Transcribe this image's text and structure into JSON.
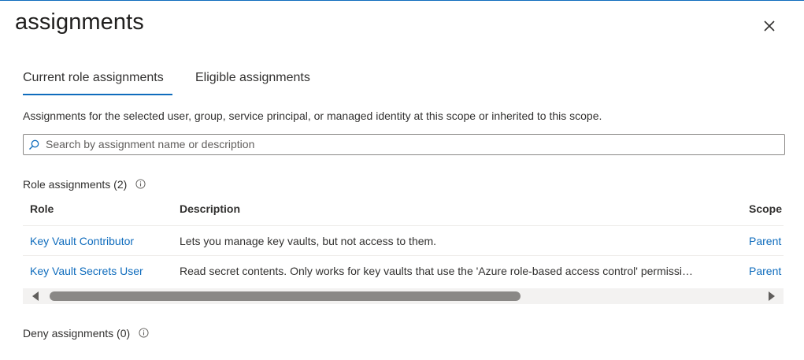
{
  "panel": {
    "title": "assignments",
    "close_icon": "close-icon"
  },
  "tabs": [
    {
      "label": "Current role assignments",
      "active": true
    },
    {
      "label": "Eligible assignments",
      "active": false
    }
  ],
  "description": "Assignments for the selected user, group, service principal, or managed identity at this scope or inherited to this scope.",
  "search": {
    "placeholder": "Search by assignment name or description",
    "value": "",
    "icon": "search-icon"
  },
  "role_assignments": {
    "label": "Role assignments (2)",
    "info_icon": "info-icon",
    "columns": [
      "Role",
      "Description",
      "Scope"
    ],
    "rows": [
      {
        "role": "Key Vault Contributor",
        "description": "Lets you manage key vaults, but not access to them.",
        "scope": "Parent"
      },
      {
        "role": "Key Vault Secrets User",
        "description": "Read secret contents. Only works for key vaults that use the 'Azure role-based access control' permissi…",
        "scope": "Parent"
      }
    ]
  },
  "deny_assignments": {
    "label": "Deny assignments (0)",
    "info_icon": "info-icon"
  },
  "colors": {
    "accent": "#0f6cbd",
    "text": "#323130",
    "border": "#8a8886"
  }
}
